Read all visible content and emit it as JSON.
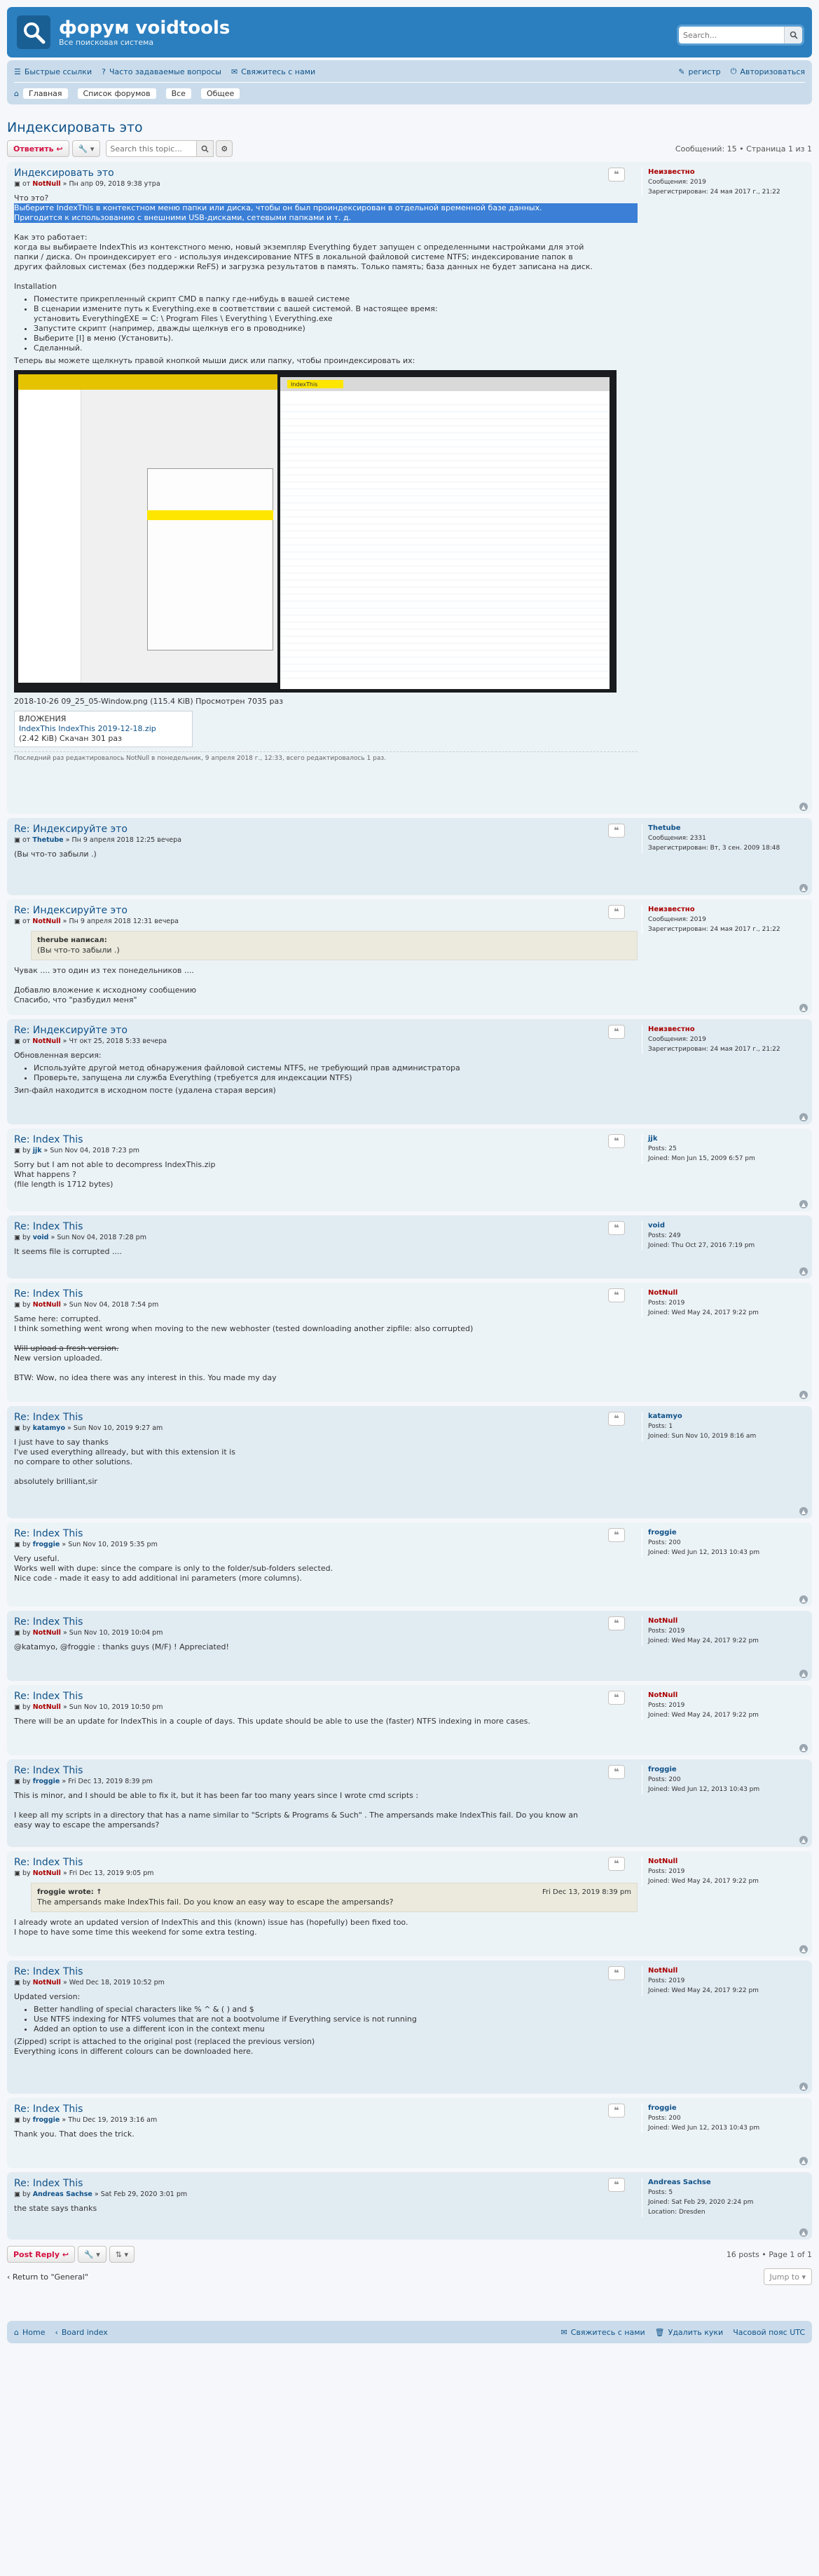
{
  "site": {
    "title": "форум voidtools",
    "subtitle": "Все поисковая система",
    "search_placeholder": "Search..."
  },
  "nav": {
    "links": [
      "Быстрые ссылки",
      "Часто задаваемые вопросы",
      "Свяжитесь с нами"
    ],
    "right": [
      "регистр",
      "Авторизоваться"
    ],
    "breadcrumbs": [
      "Главная",
      "Список форумов",
      "Все",
      "Общее"
    ]
  },
  "topic": {
    "title": "Индексировать это",
    "reply_label": "Ответить",
    "search_placeholder": "Search this topic...",
    "page_info": "Сообщений: 15 • Страница 1 из 1"
  },
  "posts": [
    {
      "title": "Индексировать это",
      "author": "NotNull",
      "by": "от",
      "date": "Пн апр 09, 2018 9:38 утра",
      "profile": {
        "name": "Неизвестно",
        "l1": "Сообщения: 2019",
        "l2": "Зарегистрирован: 24 мая 2017 г., 21:22"
      },
      "lines": [
        "Что это?",
        "Выберите IndexThis в контекстном меню папки или диска, чтобы он был проиндексирован в отдельной временной базе данных.",
        "Пригодится к использованию с внешними USB-дисками, сетевыми папками и т. д.",
        "",
        "Как это работает:",
        "когда вы выбираете IndexThis из контекстного меню, новый экземпляр Everything будет запущен с определенными настройками для этой",
        "папки / диска. Он проиндексирует его - используя индексирование NTFS в локальной файловой системе NTFS; индексирование папок в",
        "других файловых системах (без поддержки ReFS) и загрузка результатов в память. Только память; база данных не будет записана на диск.",
        "",
        "Installation"
      ],
      "list": [
        "Поместите прикрепленный скрипт CMD в папку где-нибудь в вашей системе",
        "В сценарии измените путь к Everything.exe в соответствии с вашей системой. В настоящее время:",
        "установить EverythingEXE = C: \\ Program Files \\ Everything \\ Everything.exe",
        "Запустите скрипт (например, дважды щелкнув его в проводнике)",
        "Выберите [I] в меню (Установить).",
        "Сделанный."
      ],
      "after": "Теперь вы можете щелкнуть правой кнопкой мыши диск или папку, чтобы проиндексировать их:",
      "image_caption": "2018-10-26 09_25_05-Window.png (115.4 KiB) Просмотрен 7035 раз",
      "attach_header": "ВЛОЖЕНИЯ",
      "attach_name": "IndexThis IndexThis 2019-12-18.zip",
      "attach_meta": "(2.42 KiB) Скачан 301 раз",
      "notice": "Последний раз редактировалось NotNull в понедельник, 9 апреля 2018 г., 12:33, всего редактировалось 1 раз."
    },
    {
      "title": "Re: Индексируйте это",
      "author": "Thetube",
      "by": "от",
      "date": "Пн 9 апреля 2018 12:25 вечера",
      "profile": {
        "name": "Thetube",
        "l1": "Сообщения: 2331",
        "l2": "Зарегистрирован: Вт, 3 сен. 2009 18:48"
      },
      "lines": [
        "(Вы что-то забыли  .)"
      ]
    },
    {
      "title": "Re: Индексируйте это",
      "author": "NotNull",
      "by": "от",
      "date": "Пн 9 апреля 2018 12:31 вечера",
      "profile": {
        "name": "Неизвестно",
        "l1": "Сообщения: 2019",
        "l2": "Зарегистрирован: 24 мая 2017 г., 21:22"
      },
      "quote": {
        "head": "therube написал:",
        "text": "(Вы что-то забыли  .)"
      },
      "lines": [
        "Чувак .... это один из тех понедельников ....",
        "",
        "Добавлю вложение к исходному сообщению",
        "Спасибо, что \"разбудил меня\" "
      ]
    },
    {
      "title": "Re: Индексируйте это",
      "author": "NotNull",
      "by": "от",
      "date": "Чт окт 25, 2018 5:33 вечера",
      "profile": {
        "name": "Неизвестно",
        "l1": "Сообщения: 2019",
        "l2": "Зарегистрирован: 24 мая 2017 г., 21:22"
      },
      "lines": [
        "Обновленная версия:"
      ],
      "list": [
        "Используйте другой метод обнаружения файловой системы NTFS, не требующий прав администратора",
        "Проверьте, запущена ли служба Everything (требуется для индексации NTFS)"
      ],
      "after": "Зип-файл находится в исходном посте (удалена старая версия)"
    },
    {
      "title": "Re: Index This",
      "author": "jjk",
      "by": "by",
      "date": "Sun Nov 04, 2018 7:23 pm",
      "profile": {
        "name": "jjk",
        "l1": "Posts: 25",
        "l2": "Joined: Mon Jun 15, 2009 6:57 pm"
      },
      "lines": [
        "Sorry but I am not able to decompress IndexThis.zip",
        "What happens ?",
        "(file length is 1712 bytes)"
      ]
    },
    {
      "title": "Re: Index This",
      "author": "void",
      "by": "by",
      "date": "Sun Nov 04, 2018 7:28 pm",
      "profile": {
        "name": "void",
        "l1": "Posts: 249",
        "l2": "Joined: Thu Oct 27, 2016 7:19 pm"
      },
      "lines": [
        "It seems file is corrupted ...."
      ]
    },
    {
      "title": "Re: Index This",
      "author": "NotNull",
      "by": "by",
      "date": "Sun Nov 04, 2018 7:54 pm",
      "profile": {
        "name": "NotNull",
        "l1": "Posts: 2019",
        "l2": "Joined: Wed May 24, 2017 9:22 pm"
      },
      "lines": [
        "Same here: corrupted.",
        "I think something went wrong when moving to the new webhoster (tested downloading another zipfile: also corrupted)",
        "",
        "Will upload a fresh version.",
        "New version uploaded.",
        "",
        "BTW: Wow, no idea there was any interest in this. You made my day "
      ]
    },
    {
      "title": "Re: Index This",
      "author": "katamyo",
      "by": "by",
      "date": "Sun Nov 10, 2019 9:27 am",
      "profile": {
        "name": "katamyo",
        "l1": "Posts: 1",
        "l2": "Joined: Sun Nov 10, 2019 8:16 am"
      },
      "lines": [
        "I just have to say thanks",
        "I've used everything allready, but with this extension it is",
        "no compare to other solutions.",
        "",
        "absolutely brilliant,sir"
      ]
    },
    {
      "title": "Re: Index This",
      "author": "froggie",
      "by": "by",
      "date": "Sun Nov 10, 2019 5:35 pm",
      "profile": {
        "name": "froggie",
        "l1": "Posts: 200",
        "l2": "Joined: Wed Jun 12, 2013 10:43 pm"
      },
      "lines": [
        "Very useful.",
        "Works well with dupe: since the compare is only to the folder/sub-folders selected.",
        "Nice code - made it easy to add additional ini parameters (more columns)."
      ]
    },
    {
      "title": "Re: Index This",
      "author": "NotNull",
      "by": "by",
      "date": "Sun Nov 10, 2019 10:04 pm",
      "profile": {
        "name": "NotNull",
        "l1": "Posts: 2019",
        "l2": "Joined: Wed May 24, 2017 9:22 pm"
      },
      "lines": [
        "@katamyo, @froggie : thanks guys (M/F) ! Appreciated!"
      ]
    },
    {
      "title": "Re: Index This",
      "author": "NotNull",
      "by": "by",
      "date": "Sun Nov 10, 2019 10:50 pm",
      "profile": {
        "name": "NotNull",
        "l1": "Posts: 2019",
        "l2": "Joined: Wed May 24, 2017 9:22 pm"
      },
      "lines": [
        "There will be an update for IndexThis in a couple of days. This update should be able to use the (faster) NTFS indexing in more cases."
      ]
    },
    {
      "title": "Re: Index This",
      "author": "froggie",
      "by": "by",
      "date": "Fri Dec 13, 2019 8:39 pm",
      "profile": {
        "name": "froggie",
        "l1": "Posts: 200",
        "l2": "Joined: Wed Jun 12, 2013 10:43 pm"
      },
      "lines": [
        "This is minor, and I should be able to fix it, but it has been far too many years since I wrote cmd scripts :",
        "",
        "I keep all my scripts in a directory that has a name similar to \"Scripts & Programs & Such\" . The ampersands make IndexThis fail. Do you know an",
        "easy way to escape the ampersands?"
      ]
    },
    {
      "title": "Re: Index This",
      "author": "NotNull",
      "by": "by",
      "date": "Fri Dec 13, 2019 9:05 pm",
      "profile": {
        "name": "NotNull",
        "l1": "Posts: 2019",
        "l2": "Joined: Wed May 24, 2017 9:22 pm"
      },
      "quote": {
        "head": "froggie wrote: ↑",
        "date": "Fri Dec 13, 2019 8:39 pm",
        "text": "The ampersands make IndexThis fail. Do you know an easy way to escape the ampersands?"
      },
      "lines": [
        "I already wrote an updated version of IndexThis and this (known) issue has (hopefully) been fixed too.",
        "I hope to have some time this weekend for some extra testing."
      ]
    },
    {
      "title": "Re: Index This",
      "author": "NotNull",
      "by": "by",
      "date": "Wed Dec 18, 2019 10:52 pm",
      "profile": {
        "name": "NotNull",
        "l1": "Posts: 2019",
        "l2": "Joined: Wed May 24, 2017 9:22 pm"
      },
      "lines": [
        "Updated version:"
      ],
      "list": [
        "Better handling of special characters like % ^ & ( ) and $",
        "Use NTFS indexing for NTFS volumes that are not a bootvolume if Everything service is not running",
        "Added an option to use a different icon in the context menu"
      ],
      "after": "(Zipped) script is attached to the original post (replaced the previous version)",
      "after2": "Everything icons in different colours can be downloaded here."
    },
    {
      "title": "Re: Index This",
      "author": "froggie",
      "by": "by",
      "date": "Thu Dec 19, 2019 3:16 am",
      "profile": {
        "name": "froggie",
        "l1": "Posts: 200",
        "l2": "Joined: Wed Jun 12, 2013 10:43 pm"
      },
      "lines": [
        "Thank you. That does the trick."
      ]
    },
    {
      "title": "Re: Index This",
      "author": "Andreas Sachse",
      "by": "by",
      "date": "Sat Feb 29, 2020 3:01 pm",
      "profile": {
        "name": "Andreas Sachse",
        "l1": "Posts: 5",
        "l2": "Joined: Sat Feb 29, 2020 2:24 pm",
        "l3": "Location: Dresden"
      },
      "lines": [
        "the state says thanks"
      ]
    }
  ],
  "bottom": {
    "reply_label": "Post Reply",
    "page_info": "16 posts • Page 1 of 1",
    "return": "Return to \"General\"",
    "jump": "Jump to"
  },
  "footer": {
    "left": [
      "Home",
      "Board index"
    ],
    "right": [
      "Свяжитесь с нами",
      "Удалить куки",
      "Часовой пояс UTC"
    ]
  },
  "screenshot_window_title": "IndexThis"
}
